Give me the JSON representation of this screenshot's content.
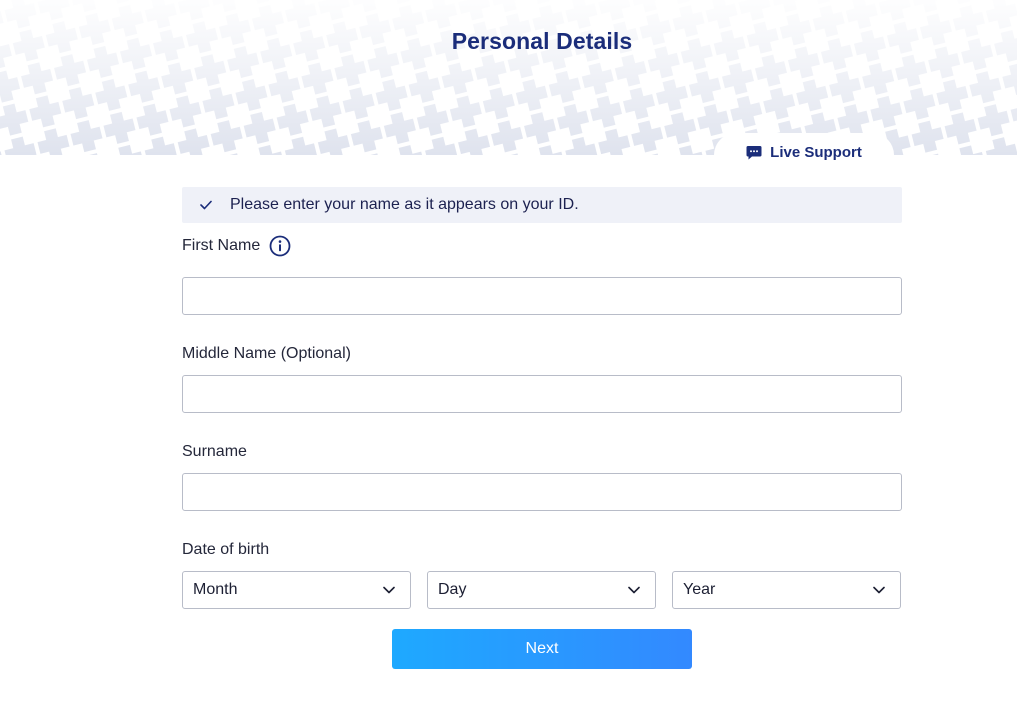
{
  "header": {
    "title": "Personal Details"
  },
  "support": {
    "label": "Live Support",
    "icon": "chat-bubble-icon"
  },
  "notice": {
    "icon": "check-icon",
    "text": "Please enter your name as it appears on your ID."
  },
  "fields": {
    "first_name": {
      "label": "First Name",
      "value": "",
      "info_icon": "info-icon"
    },
    "middle_name": {
      "label": "Middle Name (Optional)",
      "value": ""
    },
    "surname": {
      "label": "Surname",
      "value": ""
    }
  },
  "dob": {
    "label": "Date of birth",
    "month": "Month",
    "day": "Day",
    "year": "Year",
    "chevron_icon": "chevron-down-icon"
  },
  "actions": {
    "next_label": "Next"
  },
  "colors": {
    "title": "#1b2d7a",
    "notice_bg": "#eff1f8",
    "button_gradient_start": "#1ea9ff",
    "button_gradient_end": "#3389ff",
    "pattern": "#dfe3ee"
  }
}
